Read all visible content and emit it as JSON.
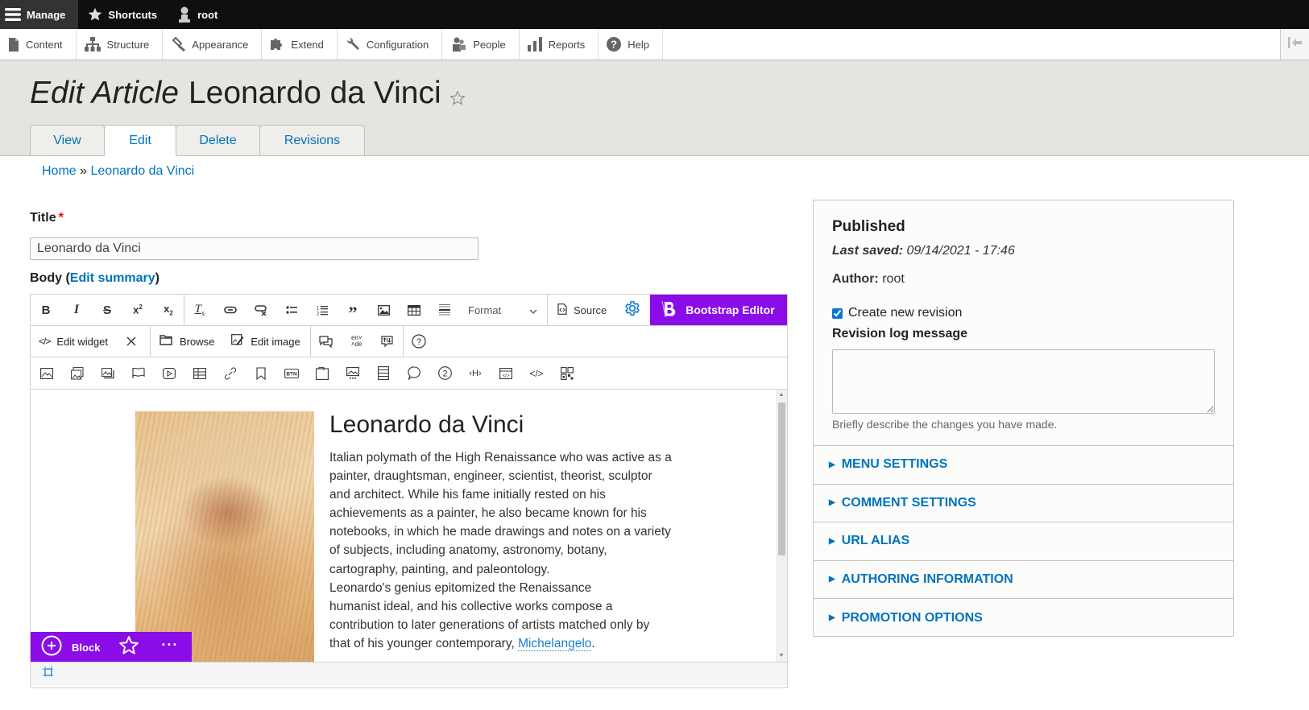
{
  "toolbar": {
    "manage_label": "Manage",
    "shortcuts_label": "Shortcuts",
    "user_label": "root"
  },
  "tray": {
    "items": [
      {
        "label": "Content",
        "icon": "file-icon"
      },
      {
        "label": "Structure",
        "icon": "sitemap-icon"
      },
      {
        "label": "Appearance",
        "icon": "paintbrush-icon"
      },
      {
        "label": "Extend",
        "icon": "puzzle-icon"
      },
      {
        "label": "Configuration",
        "icon": "wrench-icon"
      },
      {
        "label": "People",
        "icon": "people-icon"
      },
      {
        "label": "Reports",
        "icon": "bar-chart-icon"
      },
      {
        "label": "Help",
        "icon": "help-icon"
      }
    ]
  },
  "header": {
    "title_prefix": "Edit Article",
    "title_name": "Leonardo da Vinci",
    "tabs": [
      {
        "label": "View",
        "active": false
      },
      {
        "label": "Edit",
        "active": true
      },
      {
        "label": "Delete",
        "active": false
      },
      {
        "label": "Revisions",
        "active": false
      }
    ]
  },
  "breadcrumb": {
    "home": "Home",
    "separator": "»",
    "current": "Leonardo da Vinci"
  },
  "form": {
    "title_label": "Title",
    "required_mark": "*",
    "title_value": "Leonardo da Vinci",
    "body_label": "Body",
    "edit_summary": "Edit summary"
  },
  "editor": {
    "format_label": "Format",
    "source_label": "Source",
    "bootstrap_label": "Bootstrap Editor",
    "edit_widget_label": "Edit widget",
    "browse_label": "Browse",
    "edit_image_label": "Edit image",
    "lang_from": "en",
    "lang_to": "de",
    "block_label": "Block",
    "accent_color": "#8a0de8",
    "content": {
      "heading": "Leonardo da Vinci",
      "paragraph_lines": [
        "Italian polymath of the High Renaissance who was active as a",
        "painter, draughtsman, engineer, scientist, theorist, sculptor",
        "and architect. While his fame initially rested on his",
        "achievements as a painter, he also became known for his",
        "notebooks, in which he made drawings and notes on a variety",
        "of subjects, including anatomy, astronomy, botany,",
        "cartography, painting, and paleontology.",
        "Leonardo's genius epitomized the Renaissance",
        "humanist ideal, and his collective works compose a",
        "contribution to later generations of artists matched only by"
      ],
      "last_line_prefix": "that of his younger contemporary, ",
      "link_text": "Michelangelo",
      "last_line_suffix": ".",
      "image_alt": "Portrait of Leonardo da Vinci (red chalk drawing)"
    }
  },
  "sidebar": {
    "status": "Published",
    "last_saved_label": "Last saved:",
    "last_saved_value": "09/14/2021 - 17:46",
    "author_label": "Author:",
    "author_value": "root",
    "create_revision_label": "Create new revision",
    "create_revision_checked": true,
    "revision_log_label": "Revision log message",
    "revision_log_value": "",
    "revision_log_description": "Briefly describe the changes you have made.",
    "sections": [
      "MENU SETTINGS",
      "COMMENT SETTINGS",
      "URL ALIAS",
      "AUTHORING INFORMATION",
      "PROMOTION OPTIONS"
    ]
  }
}
